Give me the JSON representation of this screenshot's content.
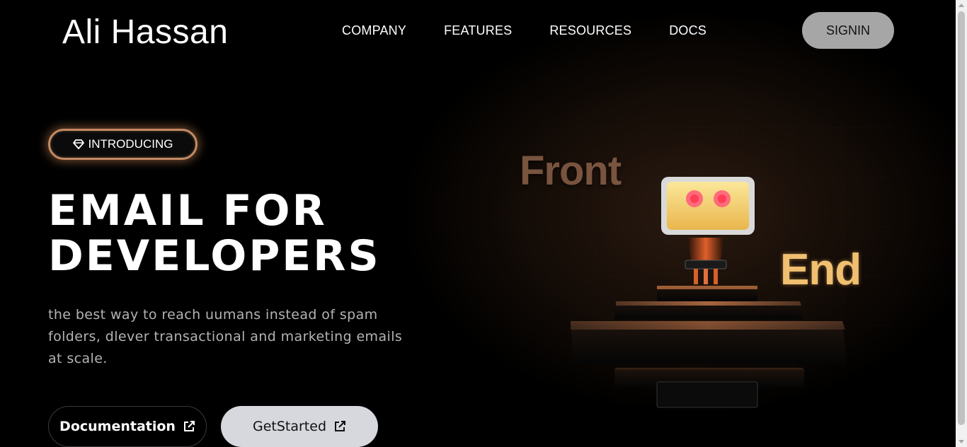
{
  "header": {
    "logo": "Ali Hassan",
    "nav": [
      "COMPANY",
      "FEATURES",
      "RESOURCES",
      "DOCS"
    ],
    "signin_label": "SIGNIN"
  },
  "hero": {
    "badge_label": "INTRODUCING",
    "headline_line1": "EMAIL FOR",
    "headline_line2": "DEVELOPERS",
    "subtext": "the best way to reach uumans instead of spam folders, dlever transactional and marketing emails at scale.",
    "documentation_label": "Documentation",
    "get_started_label": "GetStarted"
  },
  "illustration": {
    "word_front": "Front",
    "word_end": "End"
  },
  "colors": {
    "badge_border": "#c58a63",
    "signin_bg": "#a6a6a6",
    "get_started_bg": "#d6d8de",
    "end_text": "#f0c070",
    "robot_face": "#f3d27a",
    "robot_eyes": "#ff5b6e"
  },
  "icons": {
    "badge": "gem-icon",
    "buttons": "external-link-icon"
  }
}
